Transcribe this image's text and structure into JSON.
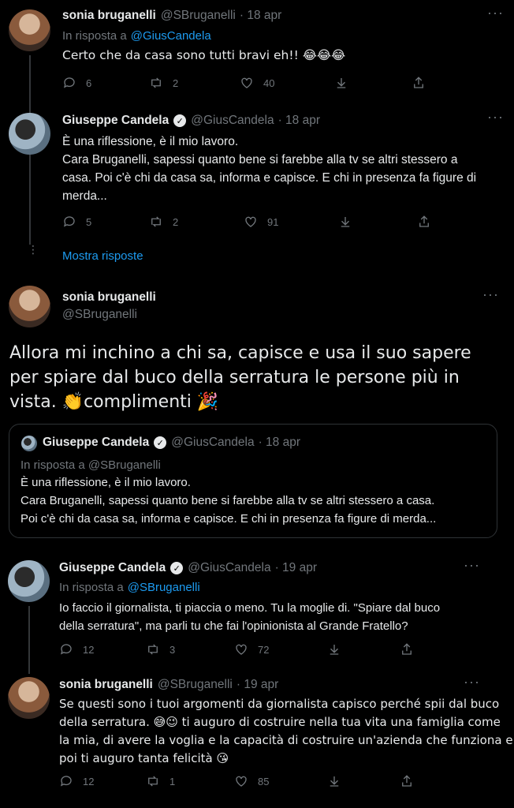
{
  "tweet1": {
    "name": "sonia bruganelli",
    "handle": "@SBruganelli",
    "date": "· 18 apr",
    "reply_prefix": "In risposta a",
    "reply_to": "@GiusCandela",
    "text": "Certo che da casa sono tutti bravi eh!! 😂😂😂",
    "replies": "6",
    "retweets": "2",
    "likes": "40"
  },
  "tweet2": {
    "name": "Giuseppe Candela",
    "handle": "@GiusCandela",
    "date": "· 18 apr",
    "lines": [
      "È una riflessione, è il mio lavoro.",
      "Cara Bruganelli, sapessi quanto bene si farebbe alla tv se altri stessero a",
      "casa. Poi c'è chi da casa sa, informa e capisce. E chi in presenza fa figure di",
      "merda..."
    ],
    "replies": "5",
    "retweets": "2",
    "likes": "91"
  },
  "show_replies": "Mostra risposte",
  "main_tweet": {
    "name": "sonia bruganelli",
    "handle": "@SBruganelli",
    "lines": [
      "Allora mi inchino a chi sa, capisce e usa il suo sapere",
      "per spiare dal buco della serratura le persone più in",
      "vista. 👏complimenti 🎉"
    ]
  },
  "quoted": {
    "name": "Giuseppe Candela",
    "handle": "@GiusCandela",
    "date": "· 18 apr",
    "reply_line": "In risposta a @SBruganelli",
    "lines": [
      "È una riflessione, è il mio lavoro.",
      "Cara Bruganelli, sapessi quanto bene si farebbe alla tv se altri stessero a casa.",
      "Poi c'è chi da casa sa, informa e capisce. E chi in presenza fa figure di merda..."
    ]
  },
  "tweet3": {
    "name": "Giuseppe Candela",
    "handle": "@GiusCandela",
    "date": "· 19 apr",
    "reply_prefix": "In risposta a",
    "reply_to": "@SBruganelli",
    "lines": [
      "Io faccio il giornalista, ti piaccia o meno. Tu la moglie di. \"Spiare dal buco",
      "della serratura\", ma parli tu che fai l'opinionista al Grande Fratello?"
    ],
    "replies": "12",
    "retweets": "3",
    "likes": "72"
  },
  "tweet4": {
    "name": "sonia bruganelli",
    "handle": "@SBruganelli",
    "date": "· 19 apr",
    "lines": [
      "Se questi sono i tuoi argomenti da giornalista capisco perché spii dal buco",
      "della serratura. 😅😉 ti auguro di costruire nella tua vita una famiglia come",
      "la mia, di avere la voglia e la capacità di costruire un'azienda che funziona e",
      "poi ti auguro tanta felicità 😘"
    ],
    "replies": "12",
    "retweets": "1",
    "likes": "85"
  },
  "icons": [
    "reply-icon",
    "retweet-icon",
    "like-icon",
    "download-icon",
    "share-icon",
    "more-icon",
    "verified-icon"
  ]
}
